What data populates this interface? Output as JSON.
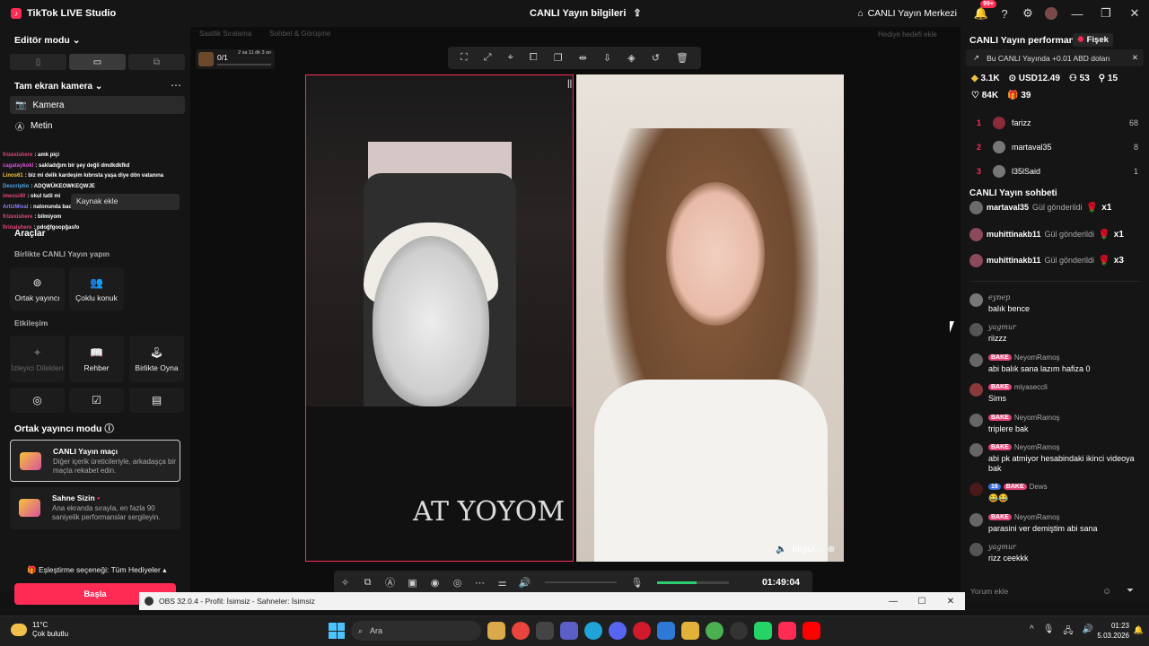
{
  "titlebar": {
    "app_title": "TikTok LIVE Studio",
    "center_title": "CANLI Yayın bilgileri",
    "live_center": "CANLI Yayın Merkezi",
    "notif_count": "99+"
  },
  "left": {
    "editor_mode": "Editör modu",
    "camera_header": "Tam ekran kamera",
    "sources": [
      "Kamera",
      "Metin"
    ],
    "chat_overlay": [
      {
        "user": "frizexishere",
        "text": "amk piçi",
        "color": "#e0457b"
      },
      {
        "user": "cagataykokl",
        "text": "sakladığım bir şey değil dmdkdkfkd",
        "color": "#d94fd9"
      },
      {
        "user": "Linos61",
        "text": "biz mi delik kardeşim kıbrısta yaşa diye dön vatanına",
        "color": "#f0c040"
      },
      {
        "user": "Descriptio",
        "text": "ADQWÜKEOWKEQWJE",
        "color": "#4fa3e0"
      },
      {
        "user": "imessi40",
        "text": "okul tatil mi",
        "color": "#e0457b"
      },
      {
        "user": "ArtizMival",
        "text": "natonunda bacısını sikyim",
        "color": "#8a7ff0"
      },
      {
        "user": "frizexishere",
        "text": "bilmiyom",
        "color": "#e0457b"
      },
      {
        "user": "firinaishere",
        "text": "pdoğfgoopğasfo",
        "color": "#e0457b"
      }
    ],
    "add_source_tip": "Kaynak ekle",
    "tools_title": "Araçlar",
    "together_label": "Birlikte CANLI Yayın yapın",
    "together_tools": [
      "Ortak yayıncı",
      "Çoklu konuk"
    ],
    "interaction_label": "Etkileşim",
    "interaction_tools": [
      "İzleyici Dilekleri",
      "Rehber",
      "Birlikte Oyna"
    ],
    "cohost_mode_title": "Ortak yayıncı modu",
    "cards": [
      {
        "title": "CANLI Yayın maçı",
        "desc": "Diğer içerik üreticileriyle, arkadaşça bir maçta rekabet edin."
      },
      {
        "title": "Sahne Sizin",
        "desc": "Ana ekranda sırayla, en fazla 90 saniyelik performanslar sergileyin."
      }
    ],
    "pairing": "Eşleştirme seçeneği: Tüm Hediyeler",
    "start_button": "Başla"
  },
  "center": {
    "gift_tabs": [
      "Saatlik Sıralama",
      "Sohbet & Görüşme"
    ],
    "gift_goal": "Hediye hedefi ekle",
    "goal_value": "0/1",
    "goal_timer": "2 sa 11 dk 3 sn",
    "guest_name": "birgul...",
    "tee_text": "AT YOYOM",
    "timer": "01:49:04",
    "mic_level": 0.55
  },
  "right": {
    "perf_title": "CANLI Yayın performansı",
    "fisek": "Fişek",
    "info": "Bu CANLI Yayında +0.01 ABD doları",
    "stats_row1": [
      "3.1K",
      "USD12.49",
      "53",
      "15"
    ],
    "stats_row2": [
      "84K",
      "39"
    ],
    "ranking": [
      {
        "rank": "1",
        "name": "farizz",
        "score": "68"
      },
      {
        "rank": "2",
        "name": "martaval35",
        "score": "8"
      },
      {
        "rank": "3",
        "name": "l35lSaid",
        "score": "1"
      }
    ],
    "chat_title": "CANLI Yayın sohbeti",
    "gifts": [
      {
        "user": "martaval35",
        "action": "Gül gönderildi",
        "count": "x1"
      },
      {
        "user": "muhittinakb11",
        "action": "Gül gönderildi",
        "count": "x1"
      },
      {
        "user": "muhittinakb11",
        "action": "Gül gönderildi",
        "count": "x3"
      }
    ],
    "messages": [
      {
        "user": "eynep",
        "badge": "",
        "lvl": "",
        "text": "balık bence"
      },
      {
        "user": "yagmur",
        "badge": "",
        "lvl": "",
        "text": "riizzz"
      },
      {
        "user": "NeyomRamoş",
        "badge": "BAKE",
        "lvl": "",
        "text": "abi balık sana lazım hafiza 0"
      },
      {
        "user": "miyaseccli",
        "badge": "BAKE",
        "lvl": "",
        "text": "Sims"
      },
      {
        "user": "NeyomRamoş",
        "badge": "BAKE",
        "lvl": "",
        "text": "triplere bak"
      },
      {
        "user": "NeyomRamoş",
        "badge": "BAKE",
        "lvl": "",
        "text": "abi pk atmiyor hesabindaki ikinci videoya bak"
      },
      {
        "user": "Dews",
        "badge": "BAKE",
        "lvl": "16",
        "text": "😂😂"
      },
      {
        "user": "NeyomRamoş",
        "badge": "BAKE",
        "lvl": "",
        "text": "parasini ver demiştim abi sana"
      },
      {
        "user": "yagmur",
        "badge": "",
        "lvl": "",
        "text": "rizz ceekkk"
      }
    ],
    "comment_placeholder": "Yorum ekle"
  },
  "obs": {
    "title": "OBS 32.0.4 - Profil: İsimsiz - Sahneler: İsimsiz"
  },
  "taskbar": {
    "temp": "11°C",
    "weather": "Çok bulutlu",
    "search": "Ara",
    "time": "01:23",
    "date": "5.03.2026"
  },
  "colors": {
    "accent": "#fe2c55",
    "panel": "#151515",
    "canvas_bg": "#0d0d0d"
  }
}
